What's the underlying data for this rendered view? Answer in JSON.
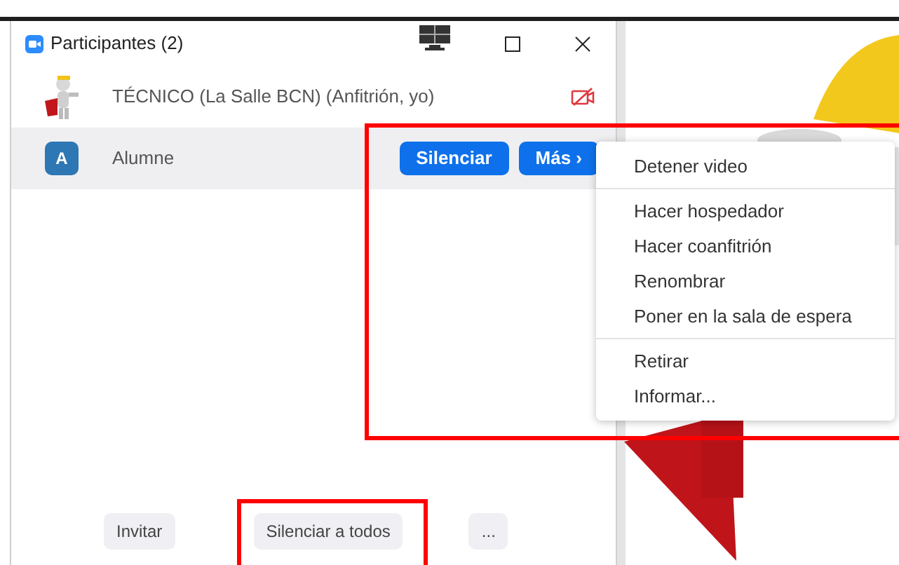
{
  "window": {
    "title": "Participantes (2)"
  },
  "participants": [
    {
      "name": "TÉCNICO (La Salle BCN) (Anfitrión, yo)",
      "video_off": true,
      "selected": false
    },
    {
      "name": "Alumne",
      "avatar": {
        "kind": "letter",
        "letter": "A"
      },
      "video_off": false,
      "selected": true,
      "actions": [
        "Silenciar",
        "Más ›"
      ]
    }
  ],
  "context_menu": {
    "highlighted": true,
    "sections": [
      [
        "Detener video"
      ],
      [
        "Hacer hospedador",
        "Hacer coanfitrión",
        "Renombrar",
        "Poner en la sala de espera"
      ],
      [
        "Retirar",
        "Informar..."
      ]
    ]
  },
  "footer_buttons": [
    {
      "label": "Invitar",
      "highlighted": false
    },
    {
      "label": "Silenciar a todos",
      "highlighted": true
    },
    {
      "label": "...",
      "highlighted": false
    }
  ]
}
